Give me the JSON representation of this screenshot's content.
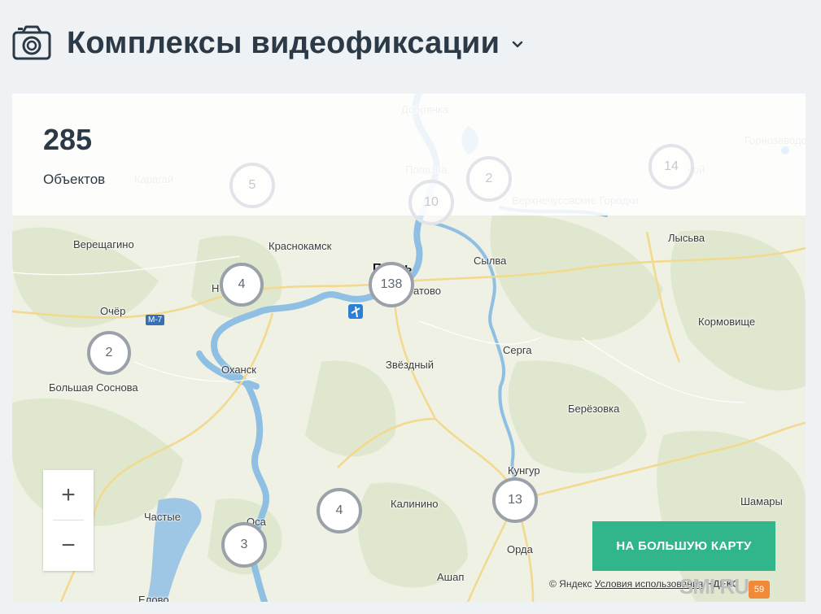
{
  "header": {
    "title": "Комплексы видеофиксации",
    "icon": "camera-icon",
    "dropdown_icon": "chevron-down-icon"
  },
  "summary": {
    "count": "285",
    "label": "Объектов"
  },
  "map": {
    "places": [
      {
        "name": "Добрянка",
        "faded": true
      },
      {
        "name": "Горнозаводск",
        "faded": true
      },
      {
        "name": "Полазна",
        "faded": true
      },
      {
        "name": "Карагай",
        "faded": true
      },
      {
        "name": "Верхнечусовские Городки",
        "faded": true
      },
      {
        "name": "Верещагино"
      },
      {
        "name": "Краснокамск"
      },
      {
        "name": "Пермь",
        "big": true
      },
      {
        "name": "Сылва"
      },
      {
        "name": "Лысьва"
      },
      {
        "name": "Очёр"
      },
      {
        "name": "Кормовище"
      },
      {
        "name": "Серга"
      },
      {
        "name": "Оханск"
      },
      {
        "name": "Звёздный"
      },
      {
        "name": "Большая Соснова"
      },
      {
        "name": "Берёзовка"
      },
      {
        "name": "Кунгур"
      },
      {
        "name": "Частые"
      },
      {
        "name": "Оса"
      },
      {
        "name": "Калинино"
      },
      {
        "name": "Шамары"
      },
      {
        "name": "Орда"
      },
      {
        "name": "Ашап"
      },
      {
        "name": "Елово"
      },
      {
        "name": "Н"
      },
      {
        "name": "атово"
      },
      {
        "name": "вой",
        "faded": true
      },
      {
        "name": "М-7",
        "road_sign": true
      }
    ],
    "clusters": [
      {
        "label": "5",
        "faded": true
      },
      {
        "label": "2",
        "faded": true
      },
      {
        "label": "10",
        "faded": true
      },
      {
        "label": "14",
        "faded": true
      },
      {
        "label": "4"
      },
      {
        "label": "138"
      },
      {
        "label": "2"
      },
      {
        "label": "13"
      },
      {
        "label": "4"
      },
      {
        "label": "3"
      }
    ],
    "zoom_in": "+",
    "zoom_out": "−",
    "big_map_button": "НА БОЛЬШУЮ КАРТУ",
    "copyright": "© Яндекс",
    "terms_link": "Условия использования",
    "brand_partial": "НДЕКС"
  },
  "watermark": {
    "text": "SMI RU",
    "badge": "59"
  },
  "colors": {
    "accent": "#30b68a",
    "title": "#2b3a46",
    "cluster_border": "#9aa1a9"
  }
}
